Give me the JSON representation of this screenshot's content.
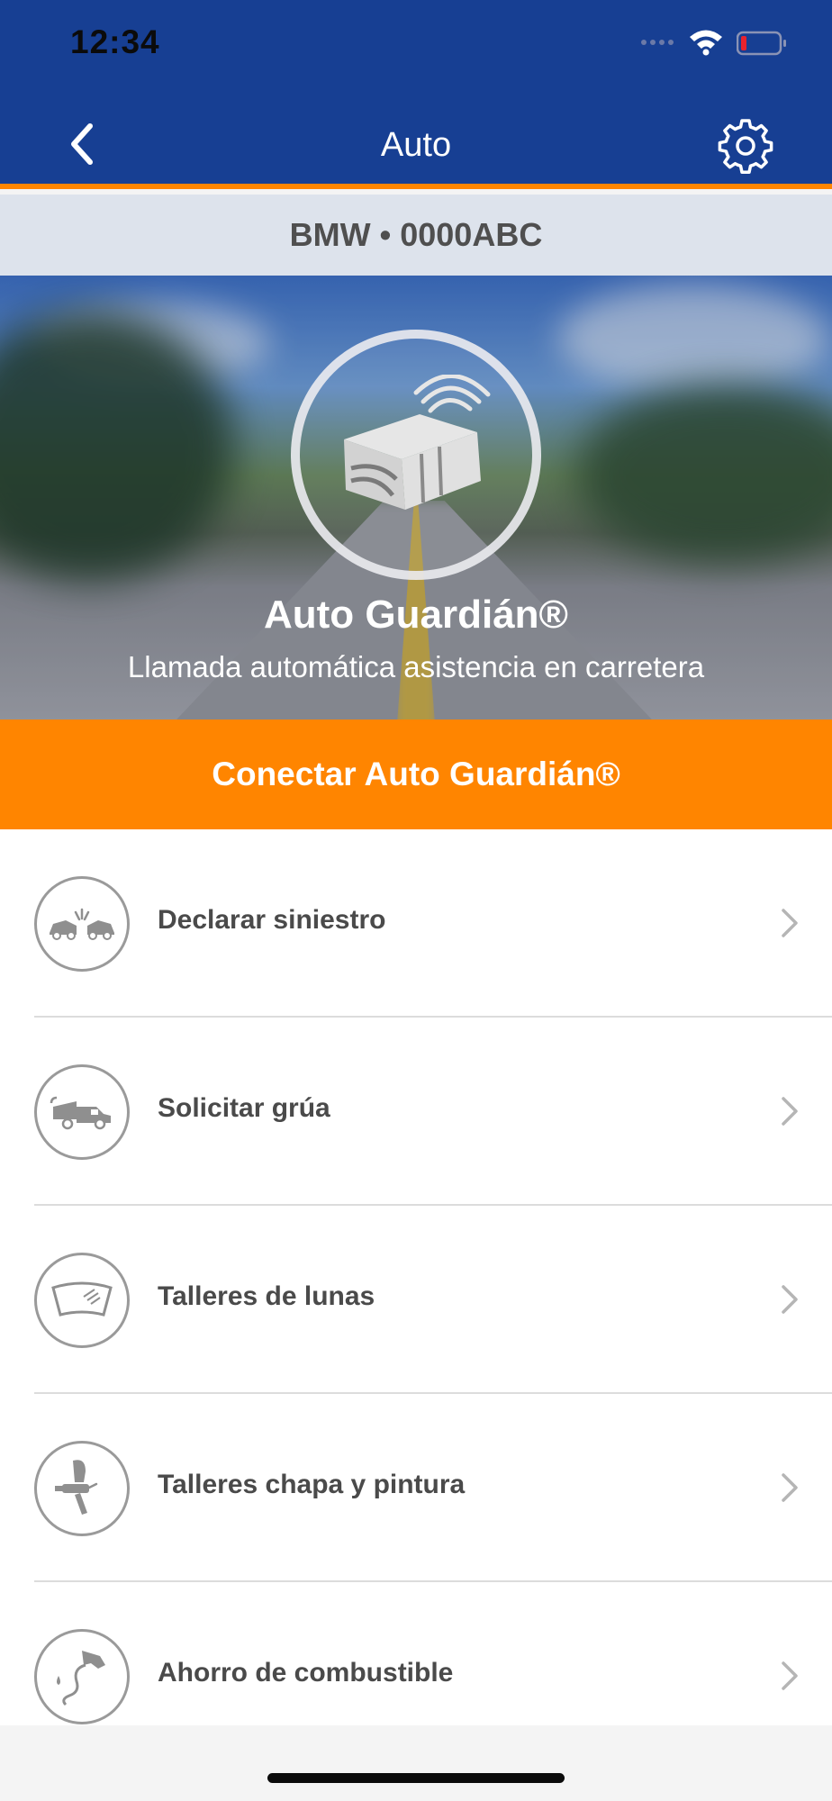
{
  "status_bar": {
    "time": "12:34"
  },
  "nav": {
    "title": "Auto",
    "back_icon": "chevron-left-icon",
    "settings_icon": "gear-icon"
  },
  "vehicle": {
    "label": "BMW • 0000ABC"
  },
  "hero": {
    "title": "Auto Guardián®",
    "subtitle": "Llamada automática asistencia en carretera",
    "icon": "connected-device-icon"
  },
  "connect_button": {
    "label": "Conectar Auto Guardián®"
  },
  "menu": {
    "items": [
      {
        "label": "Declarar siniestro",
        "icon": "car-crash-icon"
      },
      {
        "label": "Solicitar grúa",
        "icon": "tow-truck-icon"
      },
      {
        "label": "Talleres de lunas",
        "icon": "windshield-icon"
      },
      {
        "label": "Talleres chapa y pintura",
        "icon": "spray-gun-icon"
      },
      {
        "label": "Ahorro de combustible",
        "icon": "fuel-nozzle-icon"
      }
    ]
  },
  "colors": {
    "header_blue": "#173f93",
    "accent_orange": "#ff8500",
    "vehicle_bar": "#dde3ec",
    "text_dark": "#4a4a4a"
  }
}
